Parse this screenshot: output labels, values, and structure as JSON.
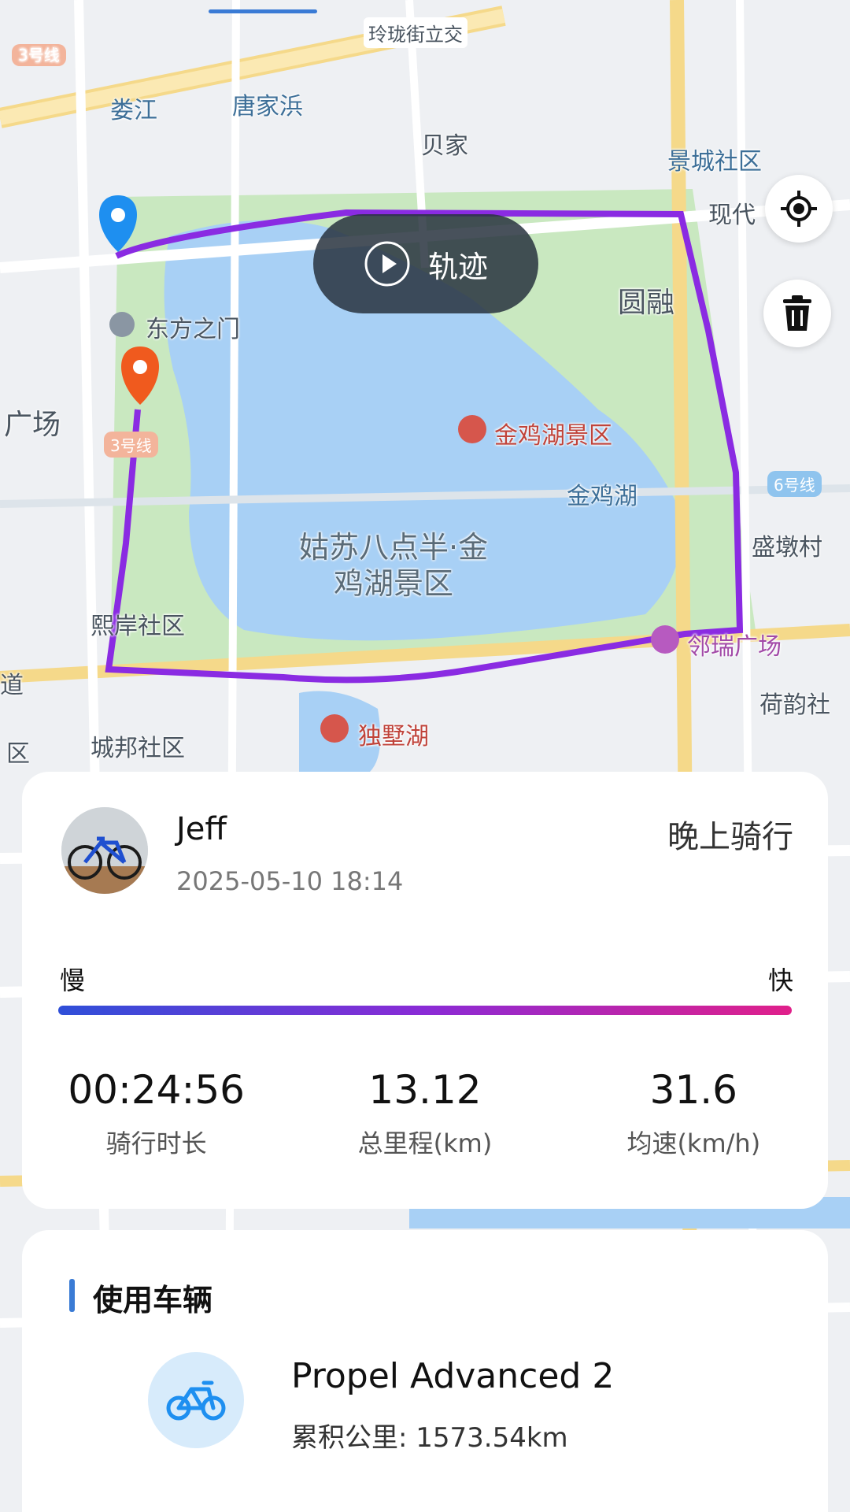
{
  "map": {
    "labels": {
      "line3_top": "3号线",
      "loujiang": "娄江",
      "tangjiabang": "唐家浜",
      "beijia": "贝家",
      "linglong": "玲珑街立交",
      "jingcheng": "景城社区",
      "xiandai": "现代",
      "yuanrong": "圆融",
      "dongfang": "东方之门",
      "guangchang": "广场",
      "line3_mid": "3号线",
      "jinjihu_scenic": "金鸡湖景区",
      "jinjihu": "金鸡湖",
      "line6": "6号线",
      "shengdun": "盛墩村",
      "gusu_line1": "姑苏八点半·金",
      "gusu_line2": "鸡湖景区",
      "xian": "熙岸社区",
      "linrui": "邻瑞广场",
      "heyun": "荷韵社",
      "dao": "道",
      "dushuhu": "独墅湖",
      "chengbang": "城邦社区",
      "qu": "区"
    },
    "track_button": {
      "label": "轨迹",
      "icon": "play-icon"
    },
    "locate_icon": "locate-icon",
    "delete_icon": "trash-icon",
    "route_color": "#8a2be2",
    "start_pin_color": "#1e8ff0",
    "end_pin_color": "#f05a1e"
  },
  "ride": {
    "user_name": "Jeff",
    "datetime": "2025-05-10 18:14",
    "title": "晚上骑行",
    "speed_slow": "慢",
    "speed_fast": "快",
    "stats": [
      {
        "value": "00:24:56",
        "label": "骑行时长"
      },
      {
        "value": "13.12",
        "label": "总里程(km)"
      },
      {
        "value": "31.6",
        "label": "均速(km/h)"
      }
    ]
  },
  "vehicle": {
    "section_title": "使用车辆",
    "name": "Propel Advanced 2",
    "mileage": "累积公里: 1573.54km",
    "icon": "bike-icon",
    "accent": "#3a7bd5"
  }
}
